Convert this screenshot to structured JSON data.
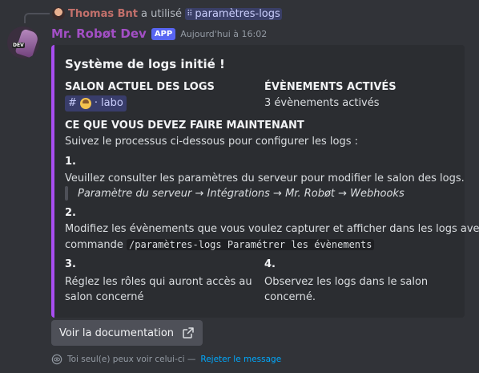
{
  "reply": {
    "username": "Thomas Bnt",
    "verb": "a utilisé",
    "command": "paramètres-logs"
  },
  "header": {
    "bot_name": "Mr. Robøt Dev",
    "badge": "APP",
    "timestamp": "Aujourd'hui à 16:02",
    "avatar_tag": "DEV"
  },
  "embed": {
    "accent_color": "#a84df0",
    "title": "Système de logs initié !",
    "field_channel_name": "SALON ACTUEL DES LOGS",
    "field_channel_value": "labo",
    "field_events_name": "ÉVÈNEMENTS ACTIVÉS",
    "field_events_value": "3 évènements activés",
    "todo_heading": "CE QUE VOUS DEVEZ FAIRE MAINTENANT",
    "todo_intro": "Suivez le processus ci-dessous pour configurer les logs :",
    "step1_num": "1.",
    "step1_text": "Veuillez consulter les paramètres du serveur pour modifier le salon des logs.",
    "step1_path": "Paramètre du serveur → Intégrations → Mr. Robøt → Webhooks",
    "step2_num": "2.",
    "step2_text_line1": "Modifiez les évènements que vous voulez capturer et afficher dans les logs avec la",
    "step2_text_line2": "commande",
    "step2_code": "/paramètres-logs Paramétrer les évènements",
    "step3_num": "3.",
    "step3_text_line1": "Réglez les rôles qui auront accès au",
    "step3_text_line2": "salon concerné",
    "step4_num": "4.",
    "step4_text_line1": "Observez les logs dans le salon",
    "step4_text_line2": "concerné."
  },
  "doc_button": {
    "label": "Voir la documentation",
    "icon": "external-link-icon"
  },
  "ephemeral": {
    "text": "Toi seul(e) peux voir celui-ci —",
    "dismiss": "Rejeter le message"
  }
}
